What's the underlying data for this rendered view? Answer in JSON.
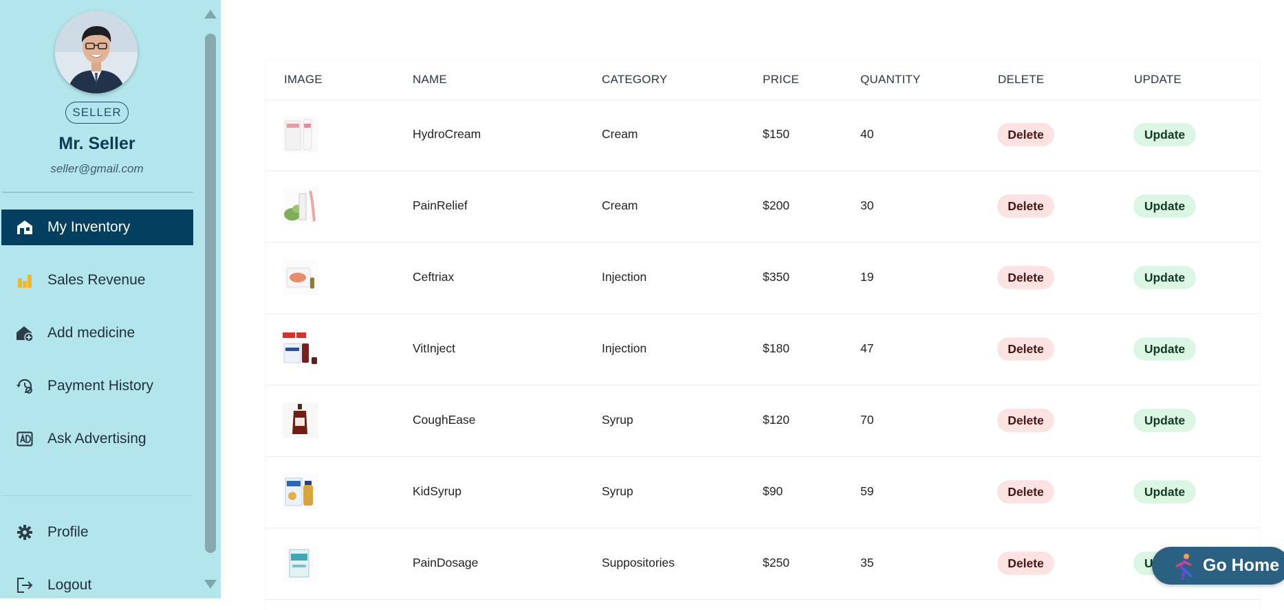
{
  "user": {
    "role": "SELLER",
    "name": "Mr. Seller",
    "email": "seller@gmail.com"
  },
  "nav": {
    "items": [
      {
        "label": "My Inventory",
        "icon": "store-icon",
        "active": true
      },
      {
        "label": "Sales Revenue",
        "icon": "bar-chart-icon",
        "active": false
      },
      {
        "label": "Add medicine",
        "icon": "house-plus-icon",
        "active": false
      },
      {
        "label": "Payment History",
        "icon": "history-icon",
        "active": false
      },
      {
        "label": "Ask Advertising",
        "icon": "ad-icon",
        "active": false
      }
    ],
    "bottom": [
      {
        "label": "Profile",
        "icon": "gear-icon"
      },
      {
        "label": "Logout",
        "icon": "logout-icon"
      }
    ]
  },
  "table": {
    "headers": [
      "IMAGE",
      "NAME",
      "CATEGORY",
      "PRICE",
      "QUANTITY",
      "DELETE",
      "UPDATE"
    ],
    "rows": [
      {
        "name": "HydroCream",
        "category": "Cream",
        "price": "$150",
        "quantity": "40",
        "delete": "Delete",
        "update": "Update"
      },
      {
        "name": "PainRelief",
        "category": "Cream",
        "price": "$200",
        "quantity": "30",
        "delete": "Delete",
        "update": "Update"
      },
      {
        "name": "Ceftriax",
        "category": "Injection",
        "price": "$350",
        "quantity": "19",
        "delete": "Delete",
        "update": "Update"
      },
      {
        "name": "VitInject",
        "category": "Injection",
        "price": "$180",
        "quantity": "47",
        "delete": "Delete",
        "update": "Update"
      },
      {
        "name": "CoughEase",
        "category": "Syrup",
        "price": "$120",
        "quantity": "70",
        "delete": "Delete",
        "update": "Update"
      },
      {
        "name": "KidSyrup",
        "category": "Syrup",
        "price": "$90",
        "quantity": "59",
        "delete": "Delete",
        "update": "Update"
      },
      {
        "name": "PainDosage",
        "category": "Suppositories",
        "price": "$250",
        "quantity": "35",
        "delete": "Delete",
        "update": "Update"
      }
    ]
  },
  "go_home": {
    "label": "Go Home"
  },
  "colors": {
    "sidebar_bg": "#b3e6ec",
    "active_nav": "#033f5f",
    "delete_bg": "#fde2e2",
    "update_bg": "#dcf6e4",
    "go_home_bg": "#2a6182"
  }
}
